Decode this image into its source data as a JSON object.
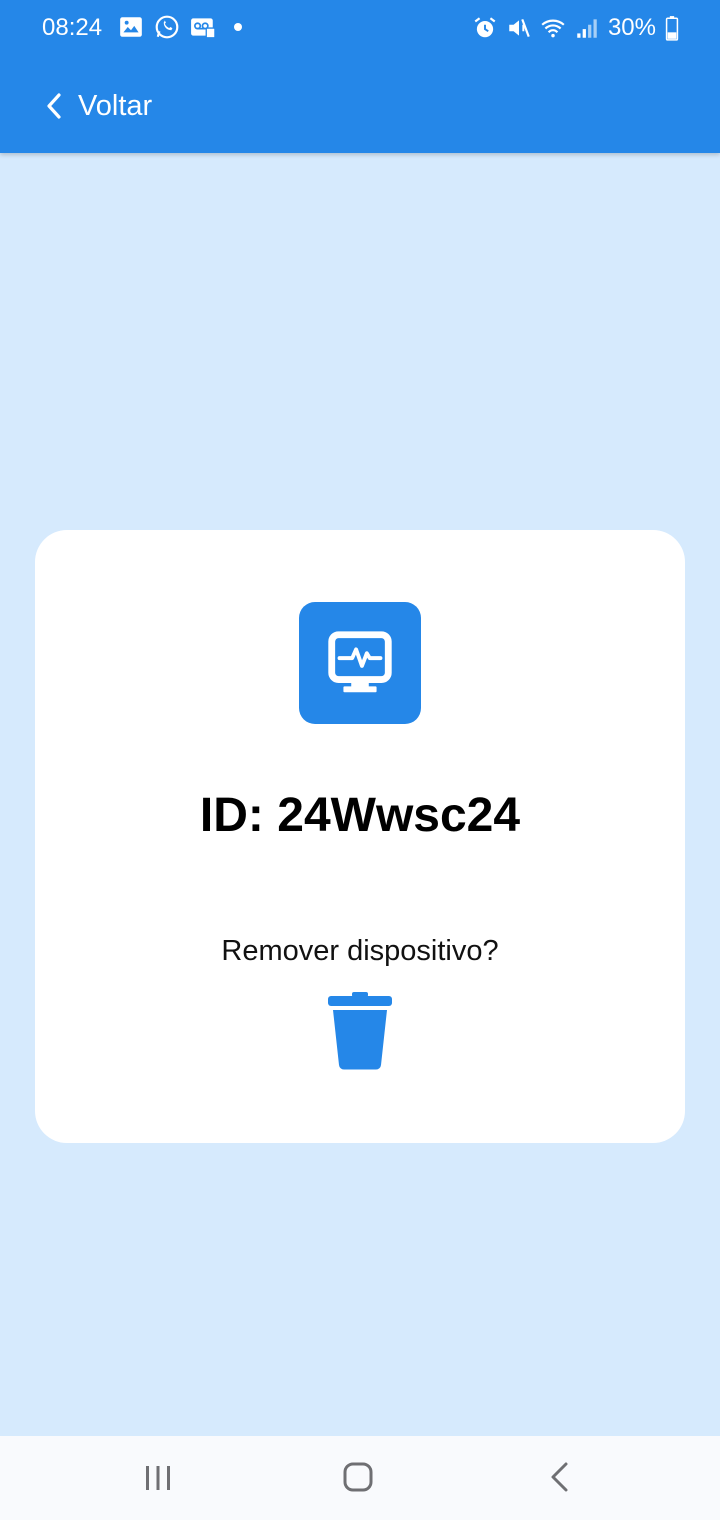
{
  "status_bar": {
    "time": "08:24",
    "battery": "30%",
    "left_icons": [
      "gallery-icon",
      "whatsapp-icon",
      "voicemail-icon"
    ],
    "right_icons": [
      "alarm-icon",
      "mute-icon",
      "wifi-icon",
      "signal-icon",
      "battery-icon"
    ]
  },
  "header": {
    "back_label": "Voltar",
    "background_color": "#2587e8"
  },
  "device_card": {
    "icon": "monitor-heartbeat-icon",
    "id_text": "ID: 24Wwsc24",
    "remove_prompt": "Remover dispositivo?",
    "remove_icon": "trash-icon",
    "accent_color": "#2587e8"
  },
  "nav_bar": {
    "buttons": [
      "recent-apps-icon",
      "home-icon",
      "back-icon"
    ]
  },
  "colors": {
    "page_background": "#d6eafd",
    "card_background": "#ffffff"
  }
}
